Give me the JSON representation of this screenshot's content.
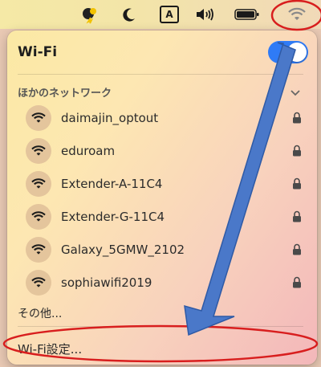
{
  "menubar": {
    "icons": [
      "weather-icon",
      "moon-icon",
      "input-source-icon",
      "volume-icon",
      "battery-icon",
      "wifi-icon"
    ],
    "input_source_label": "A"
  },
  "panel": {
    "title": "Wi-Fi",
    "toggle_on": true,
    "section_title": "ほかのネットワーク",
    "networks": [
      {
        "name": "daimajin_optout",
        "locked": true
      },
      {
        "name": "eduroam",
        "locked": true
      },
      {
        "name": "Extender-A-11C4",
        "locked": true
      },
      {
        "name": "Extender-G-11C4",
        "locked": true
      },
      {
        "name": "Galaxy_5GMW_2102",
        "locked": true
      },
      {
        "name": "sophiawifi2019",
        "locked": true
      }
    ],
    "other_label": "その他...",
    "settings_label": "Wi-Fi設定..."
  },
  "colors": {
    "accent": "#2f7bf6",
    "annotation_red": "#d81e1e",
    "annotation_arrow": "#3f6fc7"
  }
}
